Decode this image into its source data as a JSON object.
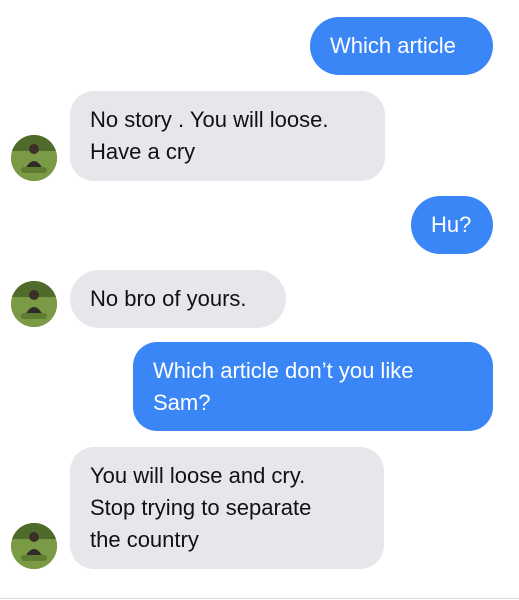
{
  "conversation": {
    "messages": [
      {
        "direction": "sent",
        "text": "Which article"
      },
      {
        "direction": "received",
        "text": "No story . You will loose.\nHave a cry"
      },
      {
        "direction": "sent",
        "text": "Hu?"
      },
      {
        "direction": "received",
        "text": "No bro of yours."
      },
      {
        "direction": "sent",
        "text": "Which article don’t you like\nSam?"
      },
      {
        "direction": "received",
        "text": "You will loose and cry.\nStop trying to separate\nthe country"
      }
    ]
  },
  "colors": {
    "sent_bubble": "#3a86f7",
    "received_bubble": "#e6e7eb",
    "sent_text": "#ffffff",
    "received_text": "#111111"
  },
  "icons": {
    "avatar": "contact-avatar-photo"
  }
}
